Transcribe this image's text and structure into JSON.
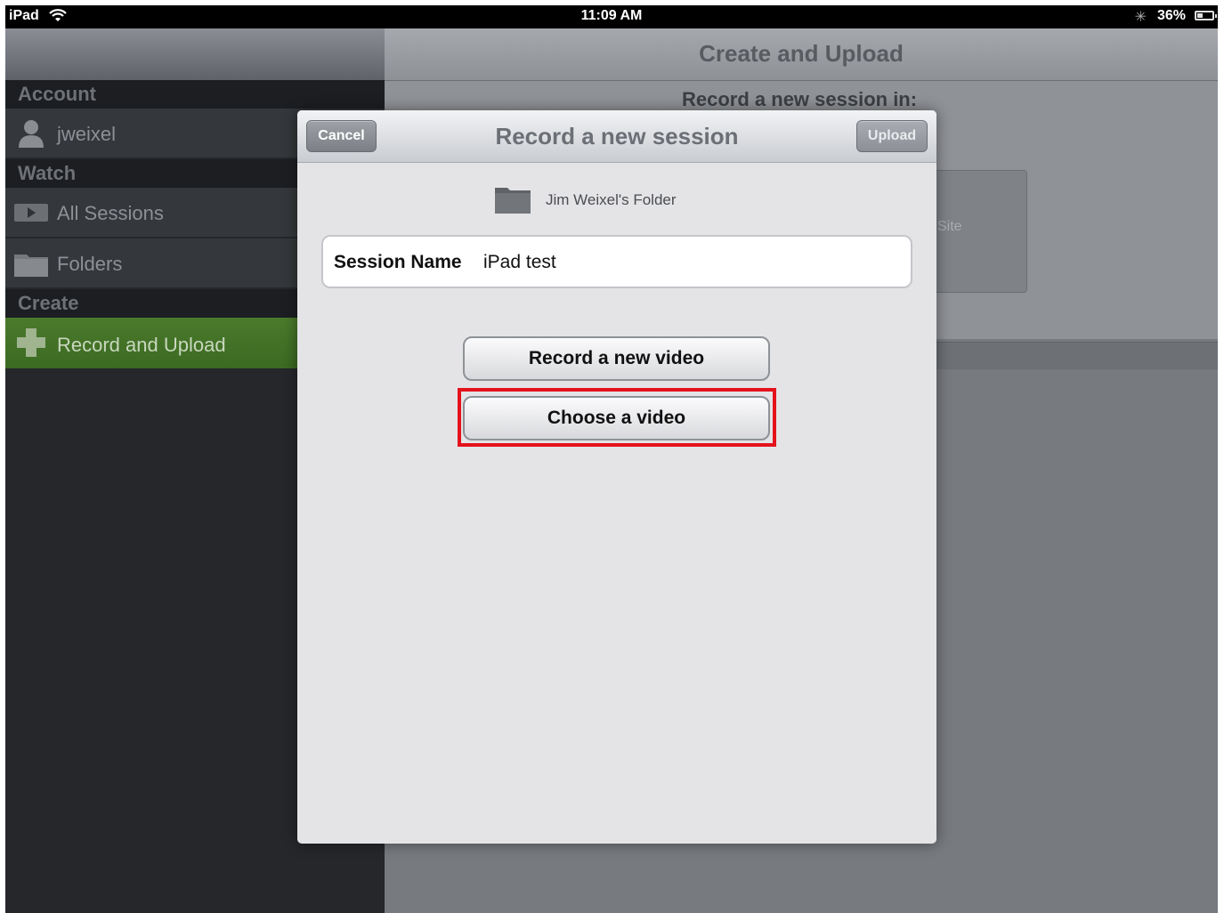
{
  "status_bar": {
    "carrier": "iPad",
    "time": "11:09 AM",
    "battery": "36%",
    "icons": [
      "wifi-icon",
      "bluetooth-icon",
      "battery-icon"
    ]
  },
  "sidebar": {
    "sections": [
      {
        "header": "Account",
        "items": [
          {
            "label": "jweixel",
            "icon": "user-icon"
          }
        ]
      },
      {
        "header": "Watch",
        "items": [
          {
            "label": "All Sessions",
            "icon": "video-icon"
          },
          {
            "label": "Folders",
            "icon": "folder-icon"
          }
        ]
      },
      {
        "header": "Create",
        "items": [
          {
            "label": "Record and Upload",
            "icon": "plus-icon",
            "selected": true
          }
        ]
      }
    ]
  },
  "main": {
    "title": "Create and Upload",
    "background_label": "Record a new session in:",
    "site_text": "Site"
  },
  "modal": {
    "title": "Record a new session",
    "cancel_label": "Cancel",
    "upload_label": "Upload",
    "folder_name": "Jim Weixel's Folder",
    "session_label": "Session Name",
    "session_value": "iPad test",
    "record_label": "Record a new video",
    "choose_label": "Choose a video"
  },
  "colors": {
    "highlight": "#e4121b",
    "selected_green": "#4b7a2c",
    "sidebar_bg": "#25272b"
  }
}
